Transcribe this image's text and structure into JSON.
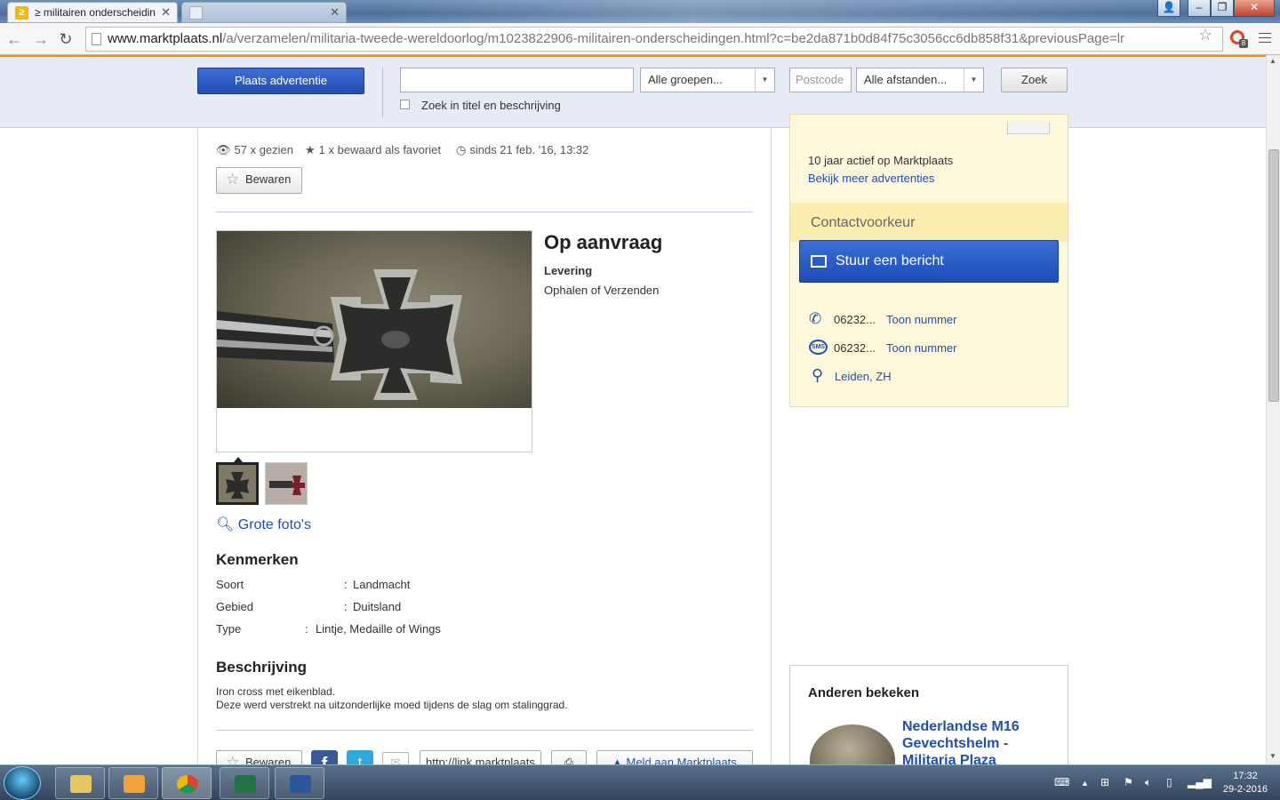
{
  "browser": {
    "tabs": [
      {
        "title": "≥ militairen onderscheidin",
        "active": true
      },
      {
        "title": "",
        "active": false
      }
    ],
    "url_domain": "www.marktplaats.nl",
    "url_path": "/a/verzamelen/militaria-tweede-wereldoorlog/m1023822906-militairen-onderscheidingen.html?c=be2da871b0d84f75c3056cc6db858f31&previousPage=lr",
    "ext_badge": "8"
  },
  "search": {
    "post_button": "Plaats advertentie",
    "query": "",
    "group_select": "Alle groepen...",
    "postcode_placeholder": "Postcode",
    "distance_select": "Alle afstanden...",
    "search_button": "Zoek",
    "title_desc_label": "Zoek in titel en beschrijving"
  },
  "listing": {
    "views": "57 x gezien",
    "favorites": "1 x bewaard als favoriet",
    "since": "sinds 21 feb. '16, 13:32",
    "save_button": "Bewaren",
    "price": "Op aanvraag",
    "delivery_label": "Levering",
    "delivery_value": "Ophalen of Verzenden",
    "large_photos_link": "Grote foto's",
    "features_title": "Kenmerken",
    "features": [
      {
        "key": "Soort",
        "value": "Landmacht"
      },
      {
        "key": "Gebied",
        "value": "Duitsland"
      },
      {
        "key": "Type",
        "value": "Lintje, Medaille of Wings"
      }
    ],
    "description_title": "Beschrijving",
    "description_lines": [
      "Iron cross met eikenblad.",
      "Deze werd verstrekt na uitzonderlijke moed tijdens de slag om stalinggrad."
    ],
    "bottom": {
      "save": "Bewaren",
      "link": "http://link.marktplaats",
      "report": "Meld aan Marktplaats"
    }
  },
  "seller": {
    "active_years": "10 jaar actief op Marktplaats",
    "more_ads": "Bekijk meer advertenties",
    "contact_title": "Contactvoorkeur",
    "message_button": "Stuur een bericht",
    "phone": "06232...",
    "sms": "06232...",
    "show_number": "Toon nummer",
    "location": "Leiden, ZH"
  },
  "others": {
    "title": "Anderen bekeken",
    "item_title": "Nederlandse M16 Gevechtshelm - Militaria Plaza"
  },
  "taskbar": {
    "time": "17:32",
    "date": "29-2-2016"
  },
  "colors": {
    "brand_blue": "#1f4fb5",
    "accent_orange": "#f39200",
    "seller_bg": "#fdf8dc"
  }
}
